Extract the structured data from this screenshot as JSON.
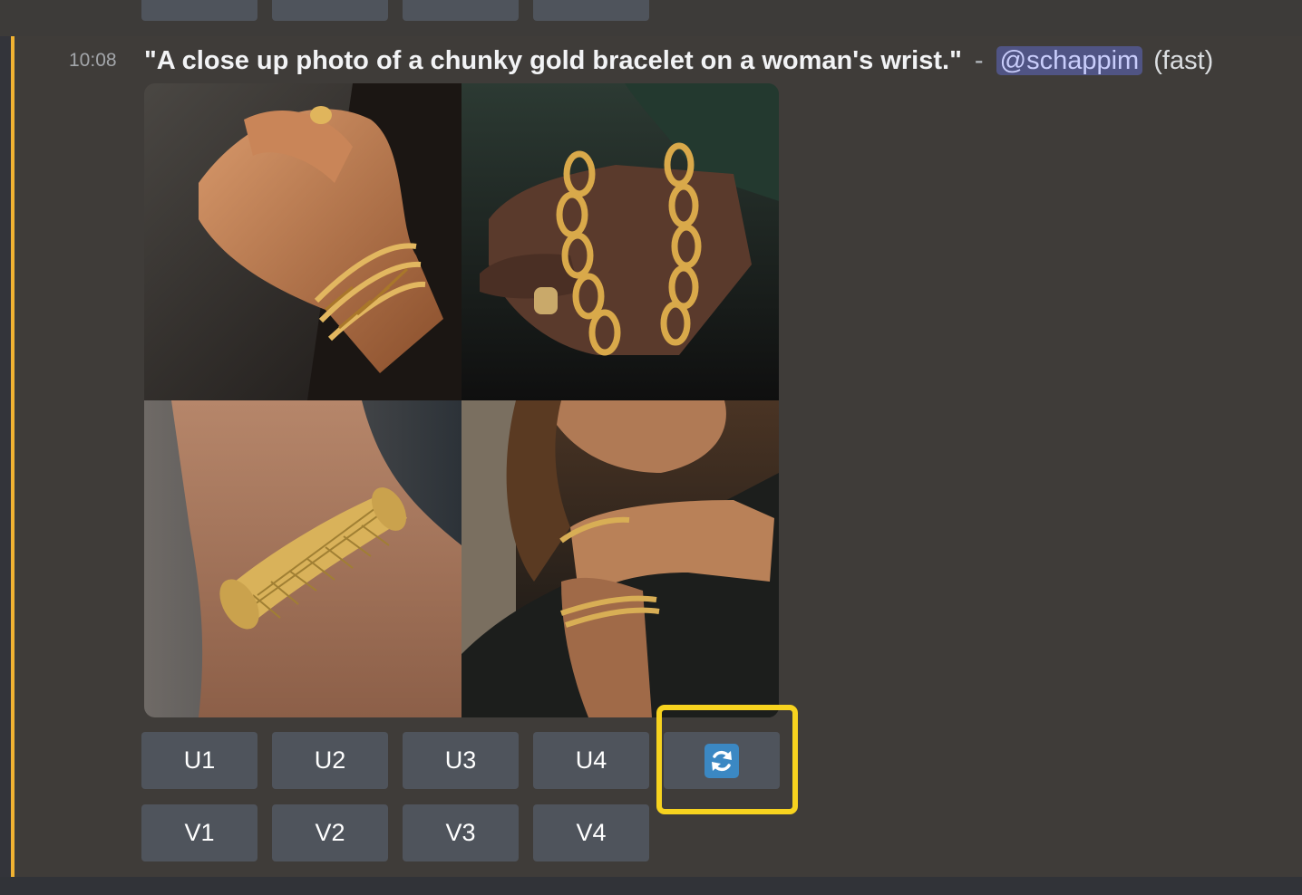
{
  "message": {
    "timestamp": "10:08",
    "prompt": "\"A close up photo of a chunky gold bracelet on a woman's wrist.\"",
    "separator": "-",
    "mention": "@schappim",
    "mode": "(fast)"
  },
  "images": [
    {
      "icon": "bracelet-photo-1"
    },
    {
      "icon": "bracelet-photo-2"
    },
    {
      "icon": "bracelet-photo-3"
    },
    {
      "icon": "bracelet-photo-4"
    }
  ],
  "buttons": {
    "upscale": [
      "U1",
      "U2",
      "U3",
      "U4"
    ],
    "variation": [
      "V1",
      "V2",
      "V3",
      "V4"
    ],
    "reroll_icon": "reroll-icon"
  },
  "colors": {
    "accent_bar": "#f0b232",
    "highlight": "#f7d31f",
    "mention_bg": "#505484",
    "button_bg": "#4f545c",
    "reroll_icon_bg": "#3b88c3"
  }
}
